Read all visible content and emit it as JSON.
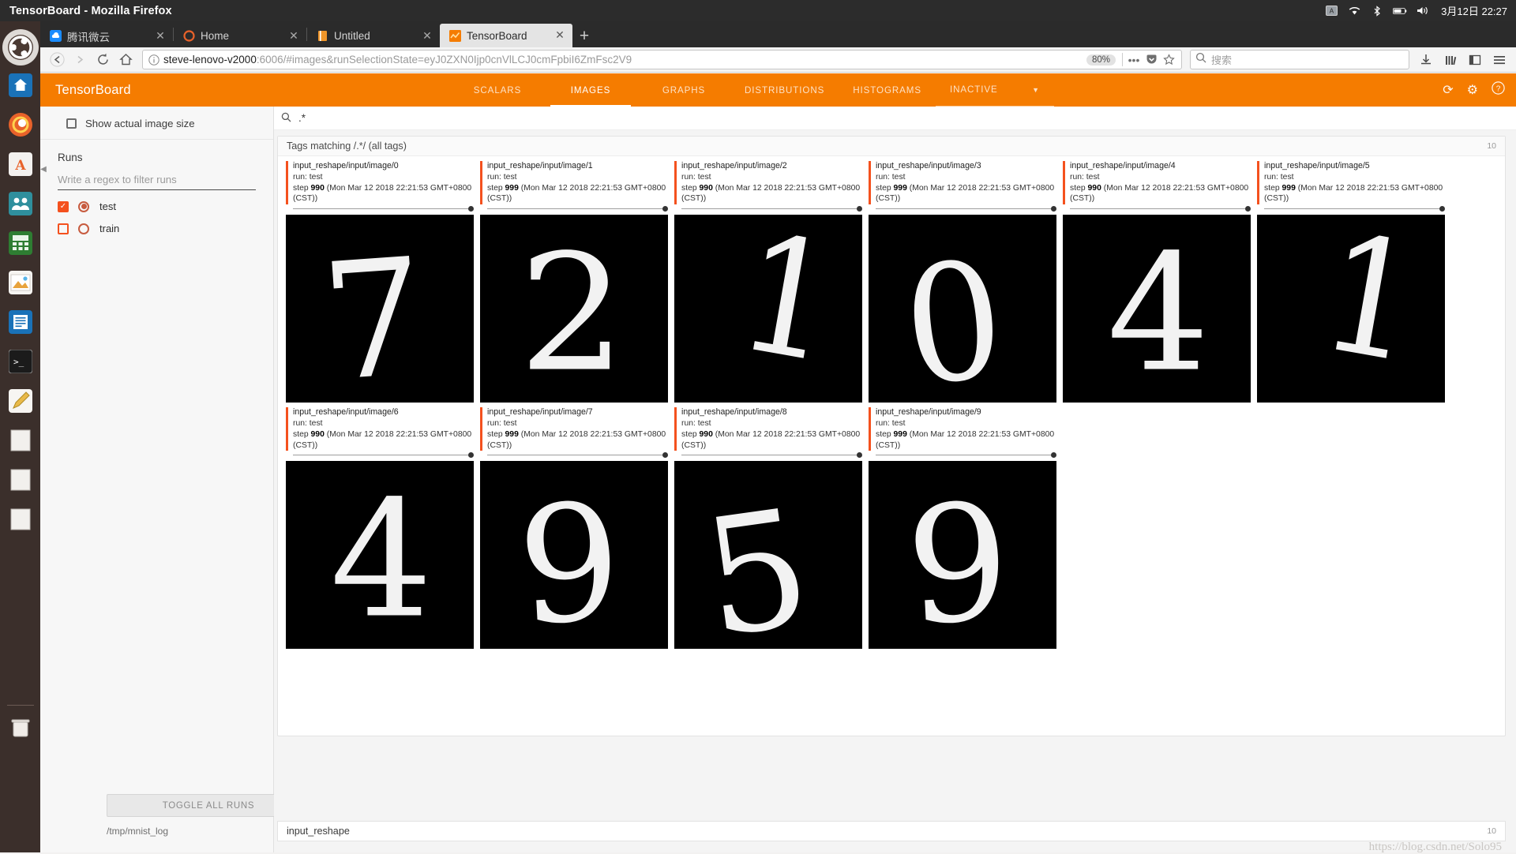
{
  "os": {
    "window_title": "TensorBoard - Mozilla Firefox",
    "clock": "3月12日 22:27",
    "tray_icons": [
      "input-method-icon",
      "wifi-icon",
      "bluetooth-icon",
      "battery-icon",
      "volume-icon"
    ]
  },
  "dock": {
    "items": [
      {
        "name": "ubuntu-logo",
        "icon": "ubuntu-icon"
      },
      {
        "name": "files-home",
        "icon": "home-icon"
      },
      {
        "name": "firefox",
        "icon": "firefox-icon"
      },
      {
        "name": "software-center",
        "icon": "amazon-a-icon"
      },
      {
        "name": "contacts",
        "icon": "people-icon"
      },
      {
        "name": "calculator",
        "icon": "calculator-icon"
      },
      {
        "name": "image-viewer",
        "icon": "picture-icon"
      },
      {
        "name": "text-editor",
        "icon": "document-icon"
      },
      {
        "name": "terminal",
        "icon": "terminal-icon"
      },
      {
        "name": "pencil-app",
        "icon": "pencil-icon"
      },
      {
        "name": "file-1",
        "icon": "blank-page-icon"
      },
      {
        "name": "file-2",
        "icon": "blank-page-icon"
      },
      {
        "name": "file-3",
        "icon": "blank-page-icon"
      },
      {
        "name": "trash",
        "icon": "trash-icon"
      }
    ]
  },
  "browser": {
    "tabs": [
      {
        "label": "腾讯微云",
        "favicon": "cloud-icon",
        "active": false
      },
      {
        "label": "Home",
        "favicon": "firefox-circle-icon",
        "active": false
      },
      {
        "label": "Untitled",
        "favicon": "book-icon",
        "active": false
      },
      {
        "label": "TensorBoard",
        "favicon": "tensorboard-icon",
        "active": true
      }
    ],
    "new_tab_label": "+",
    "close_label": "✕",
    "nav": {
      "back": "←",
      "forward": "→",
      "reload": "⟳",
      "home": "⌂"
    },
    "url": {
      "host": "steve-lenovo-v2000",
      "rest": ":6006/#images&runSelectionState=eyJ0ZXN0Ijp0cnVlLCJ0cmFpbiI6ZmFsc2V9",
      "identity_icon": "info-circle-icon",
      "zoom_level": "80%",
      "page_actions_icon": "ellipsis-icon",
      "pocket_icon": "pocket-icon",
      "bookmark_icon": "star-icon"
    },
    "search": {
      "placeholder": "搜索",
      "icon": "search-icon"
    },
    "toolbar_right": [
      {
        "name": "downloads-button",
        "icon": "download-icon"
      },
      {
        "name": "library-button",
        "icon": "library-icon"
      },
      {
        "name": "sidebar-button",
        "icon": "sidebar-icon"
      },
      {
        "name": "menu-button",
        "icon": "hamburger-icon"
      }
    ]
  },
  "tensorboard": {
    "brand": "TensorBoard",
    "accent_color": "#f57c00",
    "tabs": [
      {
        "label": "SCALARS",
        "selected": false
      },
      {
        "label": "IMAGES",
        "selected": true
      },
      {
        "label": "GRAPHS",
        "selected": false
      },
      {
        "label": "DISTRIBUTIONS",
        "selected": false
      },
      {
        "label": "HISTOGRAMS",
        "selected": false
      }
    ],
    "inactive_menu": {
      "label": "INACTIVE",
      "caret": "▼"
    },
    "actions": [
      {
        "name": "refresh-button",
        "icon": "refresh-icon",
        "glyph": "⟳"
      },
      {
        "name": "settings-button",
        "icon": "gear-icon",
        "glyph": "⚙"
      },
      {
        "name": "help-button",
        "icon": "help-circle-icon",
        "glyph": "?"
      }
    ],
    "sidebar": {
      "show_actual_size_label": "Show actual image size",
      "show_actual_size_checked": false,
      "runs_label": "Runs",
      "regex_placeholder": "Write a regex to filter runs",
      "runs": [
        {
          "name": "test",
          "checked": true
        },
        {
          "name": "train",
          "checked": false
        }
      ],
      "toggle_all_label": "TOGGLE ALL RUNS",
      "logdir": "/tmp/mnist_log",
      "collapse_handle": "◀"
    },
    "main": {
      "tag_filter_value": ".*",
      "tag_filter_icon": "search-icon",
      "group_header": "Tags matching /.*/ (all tags)",
      "group_count": "10",
      "bottom_group": "input_reshape",
      "bottom_count": "10",
      "cards": [
        {
          "title": "input_reshape/input/image/0",
          "run": "run: test",
          "step": "990",
          "time": "(Mon Mar 12 2018 22:21:53 GMT+0800 (CST))",
          "digit": "7"
        },
        {
          "title": "input_reshape/input/image/1",
          "run": "run: test",
          "step": "999",
          "time": "(Mon Mar 12 2018 22:21:53 GMT+0800 (CST))",
          "digit": "2"
        },
        {
          "title": "input_reshape/input/image/2",
          "run": "run: test",
          "step": "990",
          "time": "(Mon Mar 12 2018 22:21:53 GMT+0800 (CST))",
          "digit": "1"
        },
        {
          "title": "input_reshape/input/image/3",
          "run": "run: test",
          "step": "999",
          "time": "(Mon Mar 12 2018 22:21:53 GMT+0800 (CST))",
          "digit": "0"
        },
        {
          "title": "input_reshape/input/image/4",
          "run": "run: test",
          "step": "990",
          "time": "(Mon Mar 12 2018 22:21:53 GMT+0800 (CST))",
          "digit": "4"
        },
        {
          "title": "input_reshape/input/image/5",
          "run": "run: test",
          "step": "999",
          "time": "(Mon Mar 12 2018 22:21:53 GMT+0800 (CST))",
          "digit": "1"
        },
        {
          "title": "input_reshape/input/image/6",
          "run": "run: test",
          "step": "990",
          "time": "(Mon Mar 12 2018 22:21:53 GMT+0800 (CST))",
          "digit": "4"
        },
        {
          "title": "input_reshape/input/image/7",
          "run": "run: test",
          "step": "999",
          "time": "(Mon Mar 12 2018 22:21:53 GMT+0800 (CST))",
          "digit": "9"
        },
        {
          "title": "input_reshape/input/image/8",
          "run": "run: test",
          "step": "990",
          "time": "(Mon Mar 12 2018 22:21:53 GMT+0800 (CST))",
          "digit": "5"
        },
        {
          "title": "input_reshape/input/image/9",
          "run": "run: test",
          "step": "999",
          "time": "(Mon Mar 12 2018 22:21:53 GMT+0800 (CST))",
          "digit": "9"
        }
      ]
    }
  },
  "watermark": "https://blog.csdn.net/Solo95"
}
